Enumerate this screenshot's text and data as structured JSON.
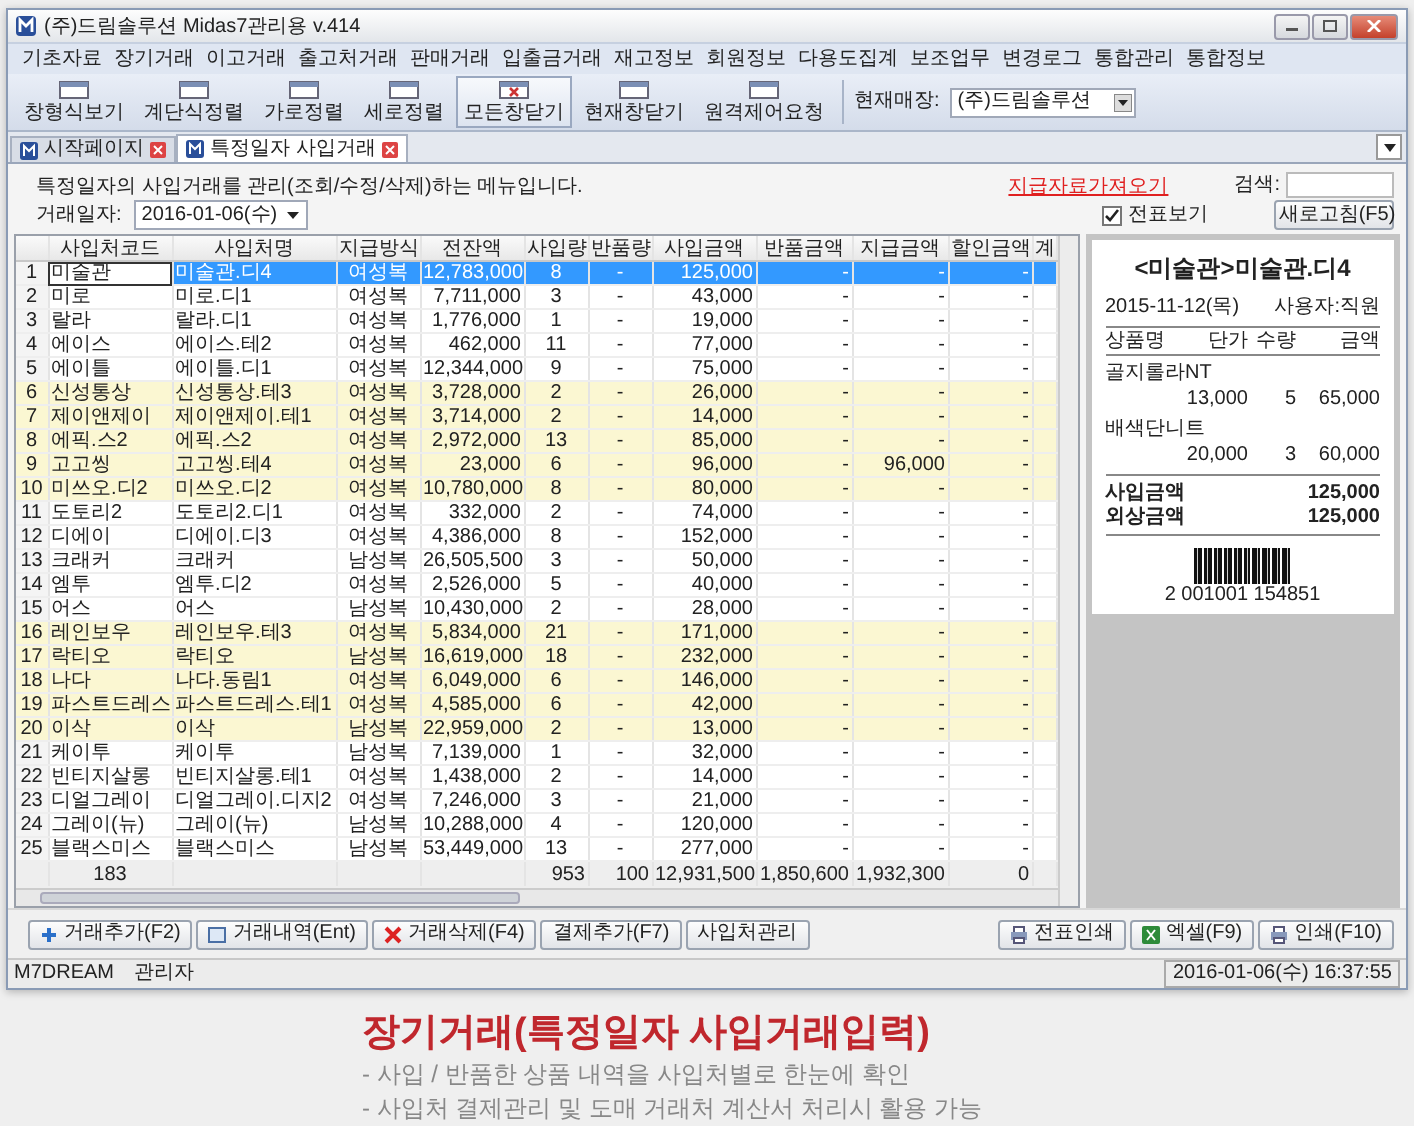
{
  "window": {
    "title": "(주)드림솔루션 Midas7관리용 v.414"
  },
  "menu": [
    "기초자료",
    "장기거래",
    "이고거래",
    "출고처거래",
    "판매거래",
    "입출금거래",
    "재고정보",
    "회원정보",
    "다용도집계",
    "보조업무",
    "변경로그",
    "통합관리",
    "통합정보"
  ],
  "toolbar": [
    {
      "label": "창형식보기",
      "selected": false
    },
    {
      "label": "계단식정렬",
      "selected": false
    },
    {
      "label": "가로정렬",
      "selected": false
    },
    {
      "label": "세로정렬",
      "selected": false
    },
    {
      "label": "모든창닫기",
      "selected": true
    },
    {
      "label": "현재창닫기",
      "selected": false
    },
    {
      "label": "원격제어요청",
      "selected": false
    }
  ],
  "store": {
    "label": "현재매장:",
    "value": "(주)드림솔루션"
  },
  "tabs": [
    {
      "label": "시작페이지",
      "selected": false
    },
    {
      "label": "특정일자 사입거래",
      "selected": true
    }
  ],
  "info": {
    "description": "특정일자의 사입거래를 관리(조회/수정/삭제)하는 메뉴입니다.",
    "link": "지급자료가져오기",
    "search_label": "검색:",
    "date_label": "거래일자:",
    "date": "2016-01-06(수)",
    "voucher": {
      "label": "전표보기",
      "checked": true
    },
    "refresh": "새로고침(F5)"
  },
  "table": {
    "columns": [
      "",
      "사입처코드",
      "사입처명",
      "지급방식",
      "전잔액",
      "사입량",
      "반품량",
      "사입금액",
      "반품금액",
      "지급금액",
      "할인금액",
      "계"
    ],
    "rows": [
      {
        "cells": [
          "1",
          "미술관",
          "미술관.디4",
          "여성복",
          "12,783,000",
          "8",
          "-",
          "125,000",
          "-",
          "-",
          "-"
        ],
        "selected": true,
        "highlighted": false
      },
      {
        "cells": [
          "2",
          "미로",
          "미로.디1",
          "여성복",
          "7,711,000",
          "3",
          "-",
          "43,000",
          "-",
          "-",
          "-"
        ],
        "selected": false,
        "highlighted": false
      },
      {
        "cells": [
          "3",
          "랄라",
          "랄라.디1",
          "여성복",
          "1,776,000",
          "1",
          "-",
          "19,000",
          "-",
          "-",
          "-"
        ],
        "selected": false,
        "highlighted": false
      },
      {
        "cells": [
          "4",
          "에이스",
          "에이스.테2",
          "여성복",
          "462,000",
          "11",
          "-",
          "77,000",
          "-",
          "-",
          "-"
        ],
        "selected": false,
        "highlighted": false
      },
      {
        "cells": [
          "5",
          "에이틀",
          "에이틀.디1",
          "여성복",
          "12,344,000",
          "9",
          "-",
          "75,000",
          "-",
          "-",
          "-"
        ],
        "selected": false,
        "highlighted": false
      },
      {
        "cells": [
          "6",
          "신성통상",
          "신성통상.테3",
          "여성복",
          "3,728,000",
          "2",
          "-",
          "26,000",
          "-",
          "-",
          "-"
        ],
        "selected": false,
        "highlighted": true
      },
      {
        "cells": [
          "7",
          "제이앤제이",
          "제이앤제이.테1",
          "여성복",
          "3,714,000",
          "2",
          "-",
          "14,000",
          "-",
          "-",
          "-"
        ],
        "selected": false,
        "highlighted": true
      },
      {
        "cells": [
          "8",
          "에픽.스2",
          "에픽.스2",
          "여성복",
          "2,972,000",
          "13",
          "-",
          "85,000",
          "-",
          "-",
          "-"
        ],
        "selected": false,
        "highlighted": true
      },
      {
        "cells": [
          "9",
          "고고씽",
          "고고씽.테4",
          "여성복",
          "23,000",
          "6",
          "-",
          "96,000",
          "-",
          "96,000",
          "-"
        ],
        "selected": false,
        "highlighted": true
      },
      {
        "cells": [
          "10",
          "미쓰오.디2",
          "미쓰오.디2",
          "여성복",
          "10,780,000",
          "8",
          "-",
          "80,000",
          "-",
          "-",
          "-"
        ],
        "selected": false,
        "highlighted": true
      },
      {
        "cells": [
          "11",
          "도토리2",
          "도토리2.디1",
          "여성복",
          "332,000",
          "2",
          "-",
          "74,000",
          "-",
          "-",
          "-"
        ],
        "selected": false,
        "highlighted": false
      },
      {
        "cells": [
          "12",
          "디에이",
          "디에이.디3",
          "여성복",
          "4,386,000",
          "8",
          "-",
          "152,000",
          "-",
          "-",
          "-"
        ],
        "selected": false,
        "highlighted": false
      },
      {
        "cells": [
          "13",
          "크래커",
          "크래커",
          "남성복",
          "26,505,500",
          "3",
          "-",
          "50,000",
          "-",
          "-",
          "-"
        ],
        "selected": false,
        "highlighted": false
      },
      {
        "cells": [
          "14",
          "엠투",
          "엠투.디2",
          "여성복",
          "2,526,000",
          "5",
          "-",
          "40,000",
          "-",
          "-",
          "-"
        ],
        "selected": false,
        "highlighted": false
      },
      {
        "cells": [
          "15",
          "어스",
          "어스",
          "남성복",
          "10,430,000",
          "2",
          "-",
          "28,000",
          "-",
          "-",
          "-"
        ],
        "selected": false,
        "highlighted": false
      },
      {
        "cells": [
          "16",
          "레인보우",
          "레인보우.테3",
          "여성복",
          "5,834,000",
          "21",
          "-",
          "171,000",
          "-",
          "-",
          "-"
        ],
        "selected": false,
        "highlighted": true
      },
      {
        "cells": [
          "17",
          "락티오",
          "락티오",
          "남성복",
          "16,619,000",
          "18",
          "-",
          "232,000",
          "-",
          "-",
          "-"
        ],
        "selected": false,
        "highlighted": true
      },
      {
        "cells": [
          "18",
          "나다",
          "나다.동림1",
          "여성복",
          "6,049,000",
          "6",
          "-",
          "146,000",
          "-",
          "-",
          "-"
        ],
        "selected": false,
        "highlighted": true
      },
      {
        "cells": [
          "19",
          "파스트드레스",
          "파스트드레스.테1",
          "여성복",
          "4,585,000",
          "6",
          "-",
          "42,000",
          "-",
          "-",
          "-"
        ],
        "selected": false,
        "highlighted": true
      },
      {
        "cells": [
          "20",
          "이삭",
          "이삭",
          "남성복",
          "22,959,000",
          "2",
          "-",
          "13,000",
          "-",
          "-",
          "-"
        ],
        "selected": false,
        "highlighted": true
      },
      {
        "cells": [
          "21",
          "케이투",
          "케이투",
          "남성복",
          "7,139,000",
          "1",
          "-",
          "32,000",
          "-",
          "-",
          "-"
        ],
        "selected": false,
        "highlighted": false
      },
      {
        "cells": [
          "22",
          "빈티지살롱",
          "빈티지살롱.테1",
          "여성복",
          "1,438,000",
          "2",
          "-",
          "14,000",
          "-",
          "-",
          "-"
        ],
        "selected": false,
        "highlighted": false
      },
      {
        "cells": [
          "23",
          "디얼그레이",
          "디얼그레이.디지2",
          "여성복",
          "7,246,000",
          "3",
          "-",
          "21,000",
          "-",
          "-",
          "-"
        ],
        "selected": false,
        "highlighted": false
      },
      {
        "cells": [
          "24",
          "그레이(뉴)",
          "그레이(뉴)",
          "남성복",
          "10,288,000",
          "4",
          "-",
          "120,000",
          "-",
          "-",
          "-"
        ],
        "selected": false,
        "highlighted": false
      },
      {
        "cells": [
          "25",
          "블랙스미스",
          "블랙스미스",
          "남성복",
          "53,449,000",
          "13",
          "-",
          "277,000",
          "-",
          "-",
          "-"
        ],
        "selected": false,
        "highlighted": false
      }
    ],
    "totals": {
      "count": "183",
      "qty": "953",
      "return_qty": "100",
      "amount": "12,931,500",
      "return_amount": "1,850,600",
      "paid_amount": "1,932,300",
      "discount": "0"
    }
  },
  "receipt": {
    "title": "<미술관>미술관.디4",
    "date": "2015-11-12(목)",
    "user": "사용자:직원",
    "columns": [
      "상품명",
      "단가",
      "수량",
      "금액"
    ],
    "items": [
      {
        "name": "골지롤라NT",
        "price": "13,000",
        "qty": "5",
        "amount": "65,000"
      },
      {
        "name": "배색단니트",
        "price": "20,000",
        "qty": "3",
        "amount": "60,000"
      }
    ],
    "summary": [
      {
        "label": "사입금액",
        "value": "125,000"
      },
      {
        "label": "외상금액",
        "value": "125,000"
      }
    ],
    "barcode": "2 001001 154851"
  },
  "buttons_left": [
    {
      "label": "거래추가(F2)",
      "kind": "add"
    },
    {
      "label": "거래내역(Ent)",
      "kind": "window"
    },
    {
      "label": "거래삭제(F4)",
      "kind": "delete"
    },
    {
      "label": "결제추가(F7)",
      "kind": "plain"
    },
    {
      "label": "사입처관리",
      "kind": "plain"
    }
  ],
  "buttons_right": [
    {
      "label": "전표인쇄",
      "kind": "print"
    },
    {
      "label": "엑셀(F9)",
      "kind": "excel"
    },
    {
      "label": "인쇄(F10)",
      "kind": "print"
    }
  ],
  "status_bar": {
    "company": "M7DREAM",
    "user": "관리자",
    "datetime": "2016-01-06(수) 16:37:55"
  },
  "caption": {
    "title": "장기거래(특정일자 사입거래입력)",
    "bullets": [
      "- 사입 / 반품한 상품 내역을 사입처별로 한눈에 확인",
      "- 사입처 결제관리 및 도매 거래처 계산서 처리시 활용 가능"
    ]
  }
}
